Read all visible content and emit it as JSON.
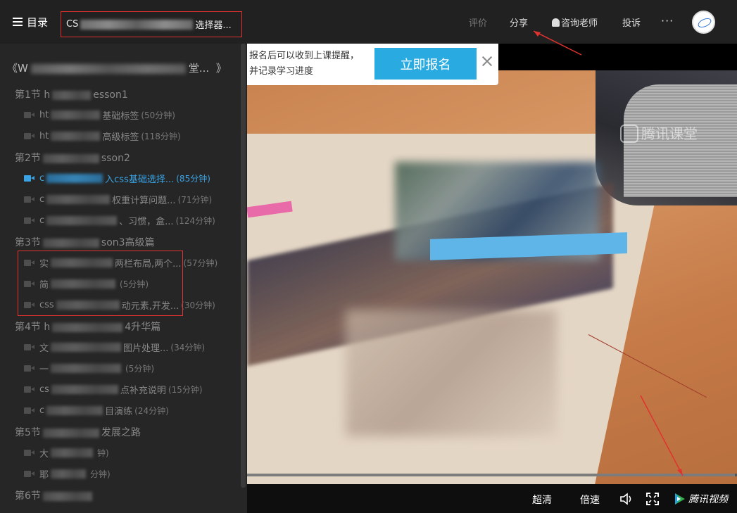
{
  "topbar": {
    "menu_label": "目录",
    "course_title_start": "CS",
    "course_title_end": "选择器...",
    "nav": {
      "review": "评价",
      "share": "分享",
      "consult": "咨询老师",
      "complain": "投诉",
      "more": "···"
    }
  },
  "sidebar": {
    "course_head_start": "《W",
    "course_head_end": "堂...",
    "course_head_close": "》",
    "sections": [
      {
        "label_start": "第1节 h",
        "label_end": "esson1"
      },
      {
        "label_start": "第2节",
        "label_end": "sson2"
      },
      {
        "label_start": "第3节",
        "label_end": "son3高级篇"
      },
      {
        "label_start": "第4节 h",
        "label_end": "4升华篇"
      },
      {
        "label_start": "第5节",
        "label_end": "发展之路"
      },
      {
        "label_start": "第6节",
        "label_end": ""
      }
    ],
    "lessons": [
      {
        "start": "ht",
        "end": "基础标签",
        "dur": "(50分钟)"
      },
      {
        "start": "ht",
        "end": "高级标签",
        "dur": "(118分钟)"
      },
      {
        "start": "c",
        "end": "入css基础选择...",
        "dur": "(85分钟)"
      },
      {
        "start": "c",
        "end": "权重计算问题...",
        "dur": "(71分钟)"
      },
      {
        "start": "c",
        "end": "、习惯，盒...",
        "dur": "(124分钟)"
      },
      {
        "start": "实",
        "end": "两栏布局,两个...",
        "dur": "(57分钟)"
      },
      {
        "start": "简",
        "end": "",
        "dur": "(5分钟)"
      },
      {
        "start": "css",
        "end": "动元素,开发...",
        "dur": "(30分钟)"
      },
      {
        "start": "文",
        "end": "图片处理...",
        "dur": "(34分钟)"
      },
      {
        "start": "一",
        "end": "",
        "dur": "(5分钟)"
      },
      {
        "start": "cs",
        "end": "点补充说明",
        "dur": "(15分钟)"
      },
      {
        "start": "c",
        "end": "目演练",
        "dur": "(24分钟)"
      },
      {
        "start": "大",
        "end": "",
        "dur": "钟)"
      },
      {
        "start": "耶",
        "end": "",
        "dur": "分钟)"
      }
    ]
  },
  "signup": {
    "line1": "报名后可以收到上课提醒，",
    "line2": "并记录学习进度",
    "button": "立即报名"
  },
  "video": {
    "watermark": "腾讯课堂",
    "progress": 0.995
  },
  "controls": {
    "quality": "超清",
    "speed": "倍速",
    "brand": "腾讯视频"
  },
  "colors": {
    "accent": "#29abe2",
    "active_lesson": "#3aa3e3",
    "annotation_red": "#e0322f"
  }
}
